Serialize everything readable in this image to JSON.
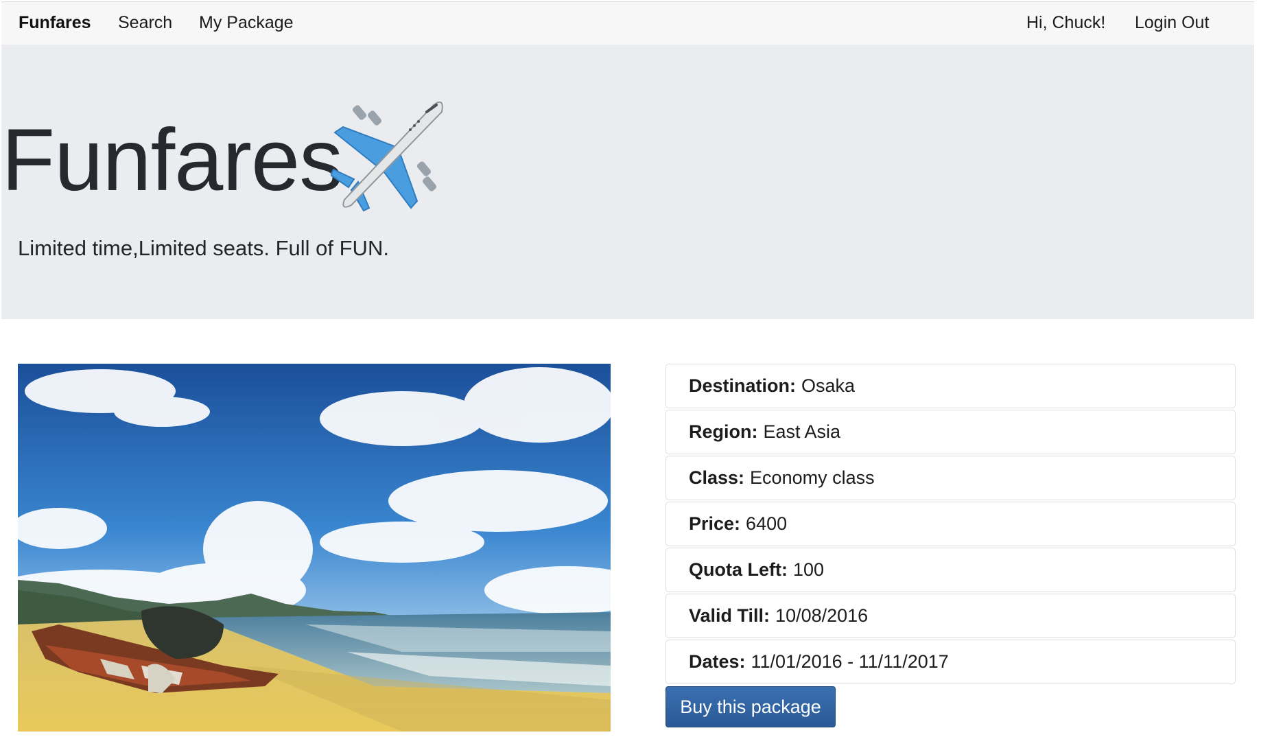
{
  "nav": {
    "brand": "Funfares",
    "search": "Search",
    "my_package": "My Package",
    "greeting": "Hi, Chuck!",
    "logout": "Login Out"
  },
  "hero": {
    "title": "Funfares",
    "icon": "airplane-icon",
    "tagline": "Limited time,Limited seats. Full of FUN."
  },
  "package": {
    "image": "beach-photo",
    "details": [
      {
        "label": "Destination:",
        "value": "Osaka"
      },
      {
        "label": "Region:",
        "value": "East Asia"
      },
      {
        "label": "Class:",
        "value": "Economy class"
      },
      {
        "label": "Price:",
        "value": "6400"
      },
      {
        "label": "Quota Left:",
        "value": "100"
      },
      {
        "label": "Valid Till:",
        "value": "10/08/2016"
      },
      {
        "label": "Dates:",
        "value": "11/01/2016 - 11/11/2017"
      }
    ],
    "buy_label": "Buy this package"
  },
  "colors": {
    "navbar_bg": "#f7f7f8",
    "jumbotron_bg": "#ebecef",
    "button_bg": "#2f61a0"
  }
}
